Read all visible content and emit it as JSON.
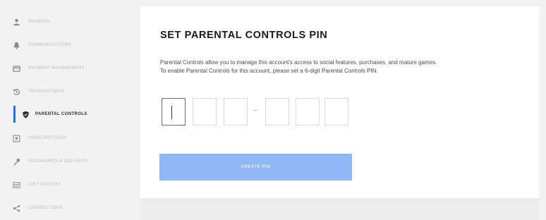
{
  "sidebar": {
    "items": [
      {
        "label": "General",
        "icon": "person-icon",
        "active": false
      },
      {
        "label": "Communications",
        "icon": "bell-icon",
        "active": false
      },
      {
        "label": "Payment Management",
        "icon": "card-icon",
        "active": false
      },
      {
        "label": "Transactions",
        "icon": "history-icon",
        "active": false
      },
      {
        "label": "Parental Controls",
        "icon": "shield-icon",
        "active": true
      },
      {
        "label": "Subscriptions",
        "icon": "subscription-icon",
        "active": false
      },
      {
        "label": "Passwords & Security",
        "icon": "key-icon",
        "active": false
      },
      {
        "label": "Gift History",
        "icon": "gift-icon",
        "active": false
      },
      {
        "label": "Connections",
        "icon": "share-icon",
        "active": false
      }
    ],
    "accent_color": "#1c74f0"
  },
  "main": {
    "title": "SET PARENTAL CONTROLS PIN",
    "description_line1": "Parental Controls allow you to manage this account's access to social features, purchases, and mature games.",
    "description_line2": "To enable Parental Controls for this account, please set a 6-digit Parental Controls PIN.",
    "pin": {
      "digits": [
        "",
        "",
        "",
        "",
        "",
        ""
      ],
      "separator": "-"
    },
    "create_button_label": "Create PIN",
    "button_color": "#8fb7f4"
  }
}
